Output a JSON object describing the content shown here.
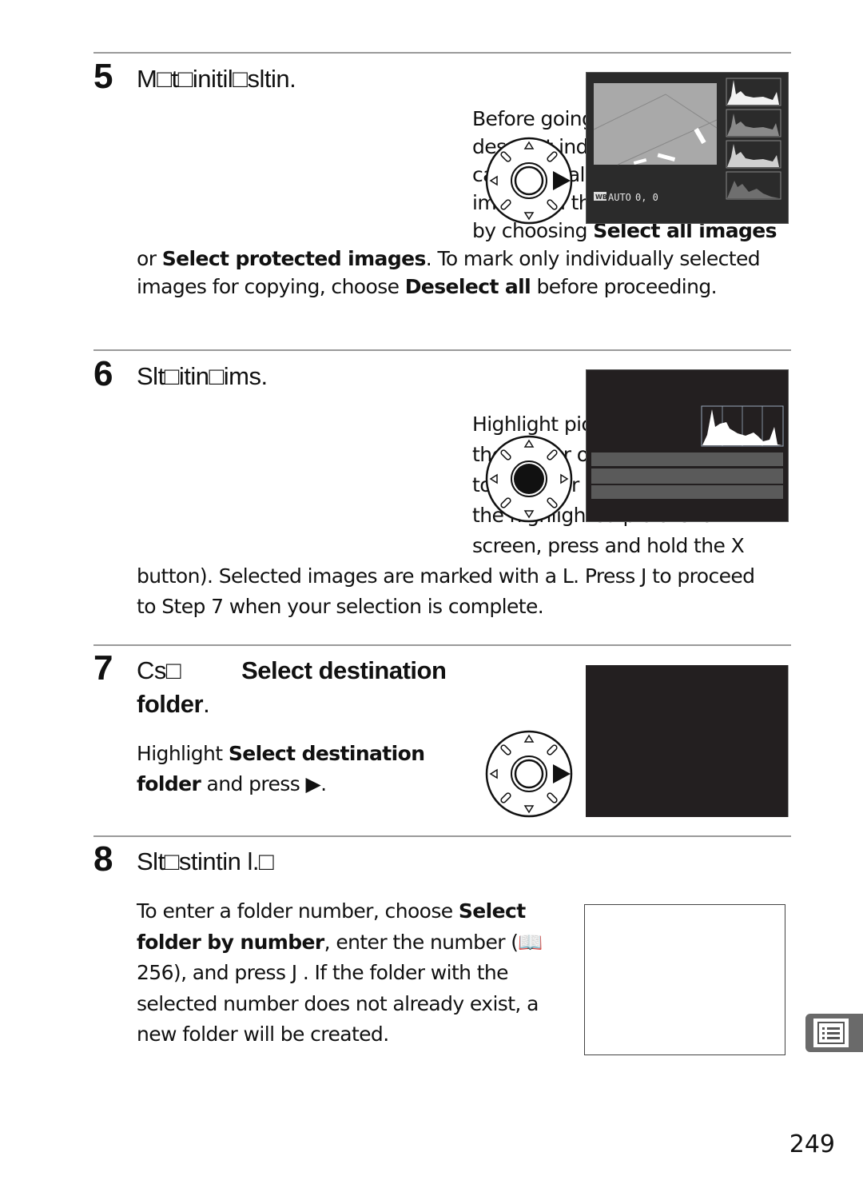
{
  "page_number": "249",
  "side_tab": {
    "icon": "menu-list-icon"
  },
  "steps": [
    {
      "number": "5",
      "heading": "M□t□initil□sltin.",
      "paragraph": {
        "parts": [
          "Before going on select or deselect individual images, you can mark all or all protected images in the folder for copying by choosing ",
          "Select all images",
          " or ",
          "Select protected images",
          ".  To mark only individually selected images for copying, choose ",
          "Deselect all",
          " before proceeding."
        ]
      },
      "dial": {
        "highlight": "right"
      },
      "screen": {
        "wb_label": "WB",
        "wb_value": "AUTO",
        "wb_offset": "0, 0"
      }
    },
    {
      "number": "6",
      "heading": "Slt□itin□ims.",
      "paragraph": {
        "parts": [
          "Highlight pictures and press the center of the multi selector to select or deselect (to view the highlighted picture full screen, press and hold the X button).  Selected images are marked with a L.  Press J  to proceed to Step 7 when your selection is complete."
        ]
      },
      "dial": {
        "highlight": "center"
      }
    },
    {
      "number": "7",
      "heading_prefix": "Cs□",
      "heading_bold": "Select destination folder",
      "heading_suffix": ".",
      "paragraph": {
        "parts": [
          "Highlight ",
          "Select destination folder",
          " and press ▶."
        ]
      },
      "dial": {
        "highlight": "right"
      }
    },
    {
      "number": "8",
      "heading": "Slt□stintin l.□",
      "paragraph": {
        "parts": [
          "To enter a folder number, choose ",
          "Select folder by number",
          ", enter the number (📖 256), and press J .  If the folder with the selected number does not already exist, a new folder will be created."
        ]
      }
    }
  ]
}
